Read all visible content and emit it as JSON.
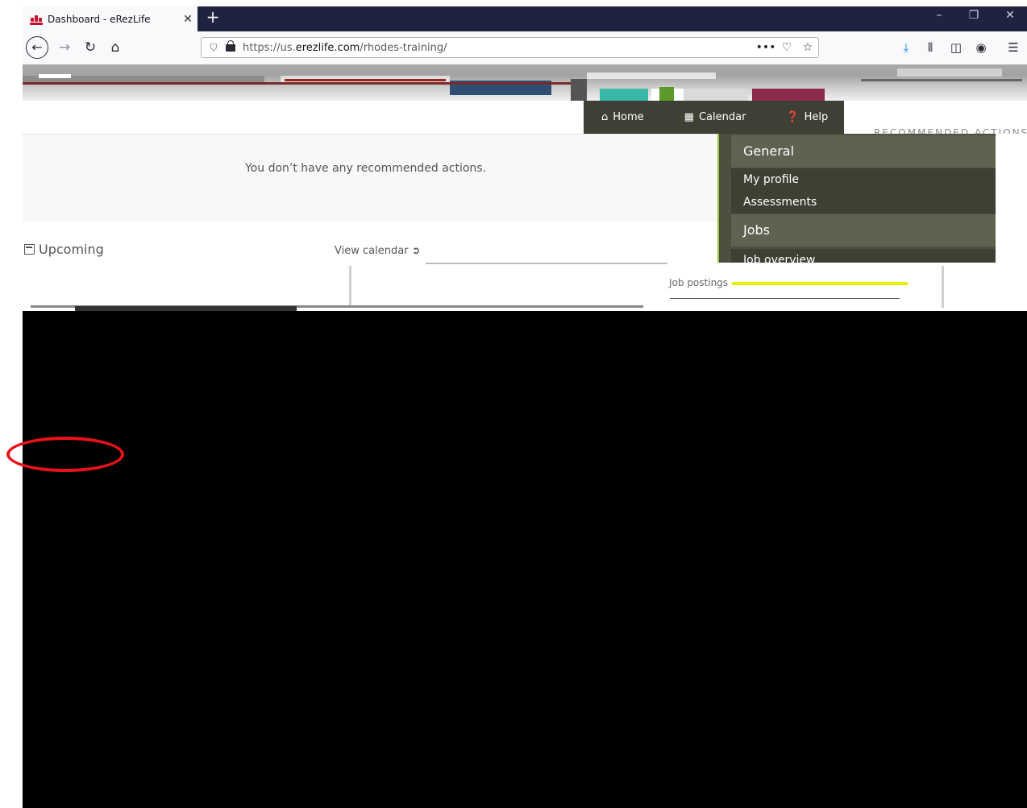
{
  "browser": {
    "tab_title": "Dashboard - eRezLife",
    "tab_close": "✕",
    "new_tab": "+",
    "window_controls": {
      "minimize": "–",
      "restore": "❐",
      "close": "✕"
    },
    "url_prefix": "https://us.",
    "url_domain": "erezlife.com",
    "url_path": "/rhodes-training/",
    "page_actions": "•••"
  },
  "nav": {
    "home": "Home",
    "calendar": "Calendar",
    "help": "Help"
  },
  "recommended": {
    "heading": "RECOMMENDED ACTIONS",
    "empty_message": "You don’t have any recommended actions."
  },
  "upcoming": {
    "title": "Upcoming",
    "view_calendar": "View calendar"
  },
  "menu": {
    "general_heading": "General",
    "my_profile": "My profile",
    "assessments": "Assessments",
    "jobs_heading": "Jobs",
    "job_overview": "Job overview",
    "job_postings": "Job postings"
  },
  "colors": {
    "tab_bar": "#202340",
    "nav_dark": "#3e4035",
    "menu_bg": "#4d503f",
    "menu_accent": "#9fc34a",
    "highlight": "#e8121a"
  },
  "icons": {
    "back": "back-arrow-icon",
    "forward": "forward-arrow-icon",
    "reload": "reload-icon",
    "home": "home-icon",
    "download": "download-icon",
    "library": "library-icon",
    "sidebar": "sidebar-icon",
    "account": "account-icon",
    "menu": "hamburger-menu-icon"
  }
}
